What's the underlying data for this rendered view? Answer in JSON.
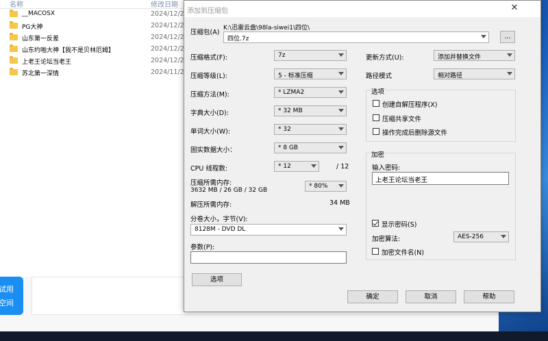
{
  "explorer": {
    "columns": {
      "name": "名称",
      "date": "修改日期"
    },
    "files": [
      {
        "name": "__MACOSX",
        "date": "2024/12/2"
      },
      {
        "name": "PG大神",
        "date": "2024/12/2"
      },
      {
        "name": "山东第一反差",
        "date": "2024/12/2"
      },
      {
        "name": "山东约啪大神【我不是贝林厄姆】",
        "date": "2024/12/2"
      },
      {
        "name": "上老王论坛当老王",
        "date": "2024/12/2"
      },
      {
        "name": "苏北第一深情",
        "date": "2024/11/2"
      }
    ],
    "promo": {
      "line1": "试用",
      "line2": "空间"
    }
  },
  "dialog": {
    "title": "添加到压缩包",
    "close": "✕",
    "archive": {
      "label": "压缩包(A)",
      "path": "K:\\迅雷云盘\\98la-siwei1\\四位\\",
      "name": "四位.7z",
      "browse": "..."
    },
    "left": {
      "format": {
        "label": "压缩格式(F):",
        "value": "7z"
      },
      "level": {
        "label": "压缩等级(L):",
        "value": "5 - 标准压缩"
      },
      "method": {
        "label": "压缩方法(M):",
        "value": "* LZMA2"
      },
      "dict": {
        "label": "字典大小(D):",
        "value": "* 32 MB"
      },
      "word": {
        "label": "单词大小(W):",
        "value": "* 32"
      },
      "solid": {
        "label": "固实数据大小：",
        "value": "* 8 GB"
      },
      "threads": {
        "label": "CPU 线程数:",
        "value": "* 12",
        "max": "/ 12"
      },
      "mem_comp": {
        "label": "压缩所需内存:",
        "detail": "3632 MB / 26 GB / 32 GB",
        "value": "* 80%"
      },
      "mem_decomp": {
        "label": "解压所需内存:",
        "value": "34 MB"
      },
      "volume": {
        "label": "分卷大小，字节(V):",
        "value": "8128M - DVD DL"
      },
      "params": {
        "label": "参数(P):",
        "value": ""
      },
      "options_btn": "选项"
    },
    "right": {
      "update": {
        "label": "更新方式(U):",
        "value": "添加并替换文件"
      },
      "path_mode": {
        "label": "路径模式",
        "value": "相对路径"
      },
      "options": {
        "title": "选项",
        "sfx": {
          "label": "创建自解压程序(X)",
          "checked": false
        },
        "shared": {
          "label": "压缩共享文件",
          "checked": false
        },
        "delete": {
          "label": "操作完成后删除源文件",
          "checked": false
        }
      },
      "encryption": {
        "title": "加密",
        "pw_label": "输入密码:",
        "pw_value": "上老王论坛当老王",
        "show_pw": {
          "label": "显示密码(S)",
          "checked": true
        },
        "method": {
          "label": "加密算法:",
          "value": "AES-256"
        },
        "enc_names": {
          "label": "加密文件名(N)",
          "checked": false
        }
      }
    },
    "buttons": {
      "ok": "确定",
      "cancel": "取消",
      "help": "帮助"
    }
  }
}
